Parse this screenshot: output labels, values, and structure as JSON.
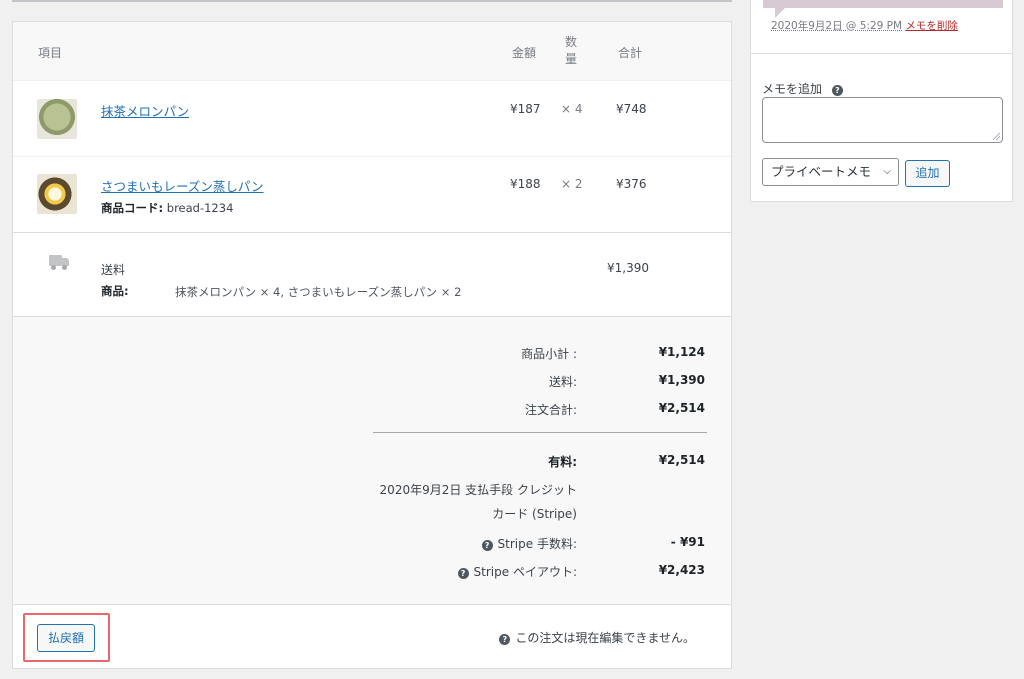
{
  "table_header": {
    "item": "項目",
    "price": "金額",
    "qty": "数\n量",
    "total": "合計"
  },
  "line_items": [
    {
      "name": "抹茶メロンパン",
      "price": "¥187",
      "qty": "× 4",
      "total": "¥748",
      "meta_label": "",
      "meta_value": ""
    },
    {
      "name": "さつまいもレーズン蒸しパン",
      "price": "¥188",
      "qty": "× 2",
      "total": "¥376",
      "meta_label": "商品コード:",
      "meta_value": "bread-1234"
    }
  ],
  "shipping": {
    "name": "送料",
    "items_label": "商品:",
    "items_value": "抹茶メロンパン × 4, さつまいもレーズン蒸しパン × 2",
    "total": "¥1,390"
  },
  "totals": {
    "subtotal_label": "商品小計 :",
    "subtotal_value": "¥1,124",
    "shipping_label": "送料:",
    "shipping_value": "¥1,390",
    "order_total_label": "注文合計:",
    "order_total_value": "¥2,514",
    "paid_label": "有料:",
    "paid_value": "¥2,514",
    "paid_note_line1": "2020年9月2日 支払手段 クレジット",
    "paid_note_line2": "カード (Stripe)",
    "fee_label": "Stripe 手数料:",
    "fee_value": "- ¥91",
    "payout_label": "Stripe ペイアウト:",
    "payout_value": "¥2,423"
  },
  "actions": {
    "refund_label": "払戻額",
    "notice": "この注文は現在編集できません。"
  },
  "side": {
    "note_date": "2020年9月2日 @ 5:29 PM",
    "delete_label": "メモを削除",
    "add_note_label": "メモを追加",
    "textarea_value": "",
    "note_type_selected": "プライベートメモ",
    "add_button_label": "追加"
  },
  "colors": {
    "link": "#2271b1",
    "delete": "#b32d2e",
    "highlight": "#e8686c"
  },
  "icons": {
    "shipping": "truck-icon",
    "help": "help-icon"
  }
}
